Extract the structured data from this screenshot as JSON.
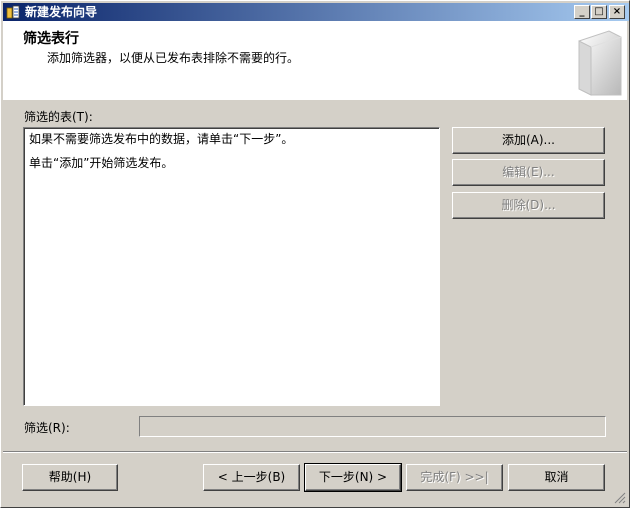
{
  "window": {
    "title": "新建发布向导",
    "controls": {
      "minimize": "_",
      "maximize": "□",
      "close": "×"
    }
  },
  "header": {
    "title": "筛选表行",
    "subtitle": "添加筛选器，以便从已发布表排除不需要的行。"
  },
  "filtered_tables": {
    "label": "筛选的表(T):",
    "lines": [
      "如果不需要筛选发布中的数据，请单击“下一步”。",
      "单击“添加”开始筛选发布。"
    ]
  },
  "side_buttons": {
    "add": "添加(A)...",
    "edit": "编辑(E)...",
    "delete": "删除(D)..."
  },
  "filter": {
    "label": "筛选(R):",
    "value": ""
  },
  "footer_buttons": {
    "help": "帮助(H)",
    "back": "< 上一步(B)",
    "next": "下一步(N) >",
    "finish": "完成(F) >>|",
    "cancel": "取消"
  },
  "colors": {
    "titlebar_start": "#0a246a",
    "titlebar_end": "#a6caf0",
    "face": "#d4d0c8"
  }
}
